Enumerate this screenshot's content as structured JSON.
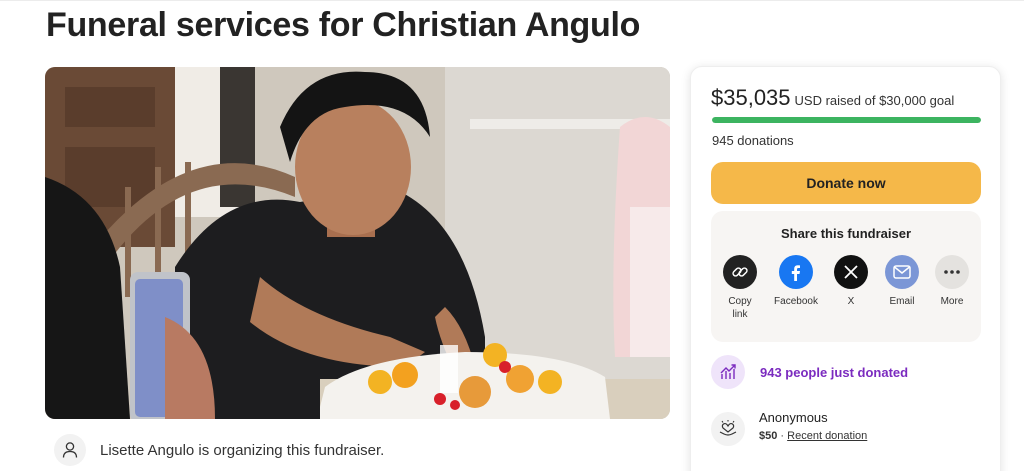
{
  "page": {
    "title": "Funeral services for Christian Angulo"
  },
  "organizer": {
    "text": "Lisette Angulo is organizing this fundraiser.",
    "icon": "person-icon"
  },
  "donation_card": {
    "raised_amount": "$35,035",
    "raised_label": "USD raised of $30,000 goal",
    "progress_fraction": 1.0,
    "progress_color": "#3cb460",
    "donations_count": "945 donations",
    "donate_button": "Donate now",
    "donate_button_color": "#f5b849"
  },
  "share": {
    "title": "Share this fundraiser",
    "items": [
      {
        "label": "Copy link",
        "icon": "link-icon"
      },
      {
        "label": "Facebook",
        "icon": "facebook-icon"
      },
      {
        "label": "X",
        "icon": "x-icon"
      },
      {
        "label": "Email",
        "icon": "email-icon"
      },
      {
        "label": "More",
        "icon": "more-icon"
      }
    ]
  },
  "activity": {
    "text": "943 people just donated",
    "icon": "trending-up-icon",
    "color": "#7b2bbf"
  },
  "recent_donation": {
    "name": "Anonymous",
    "amount": "$50",
    "separator": "·",
    "label": "Recent donation",
    "icon": "heart-hand-icon"
  }
}
